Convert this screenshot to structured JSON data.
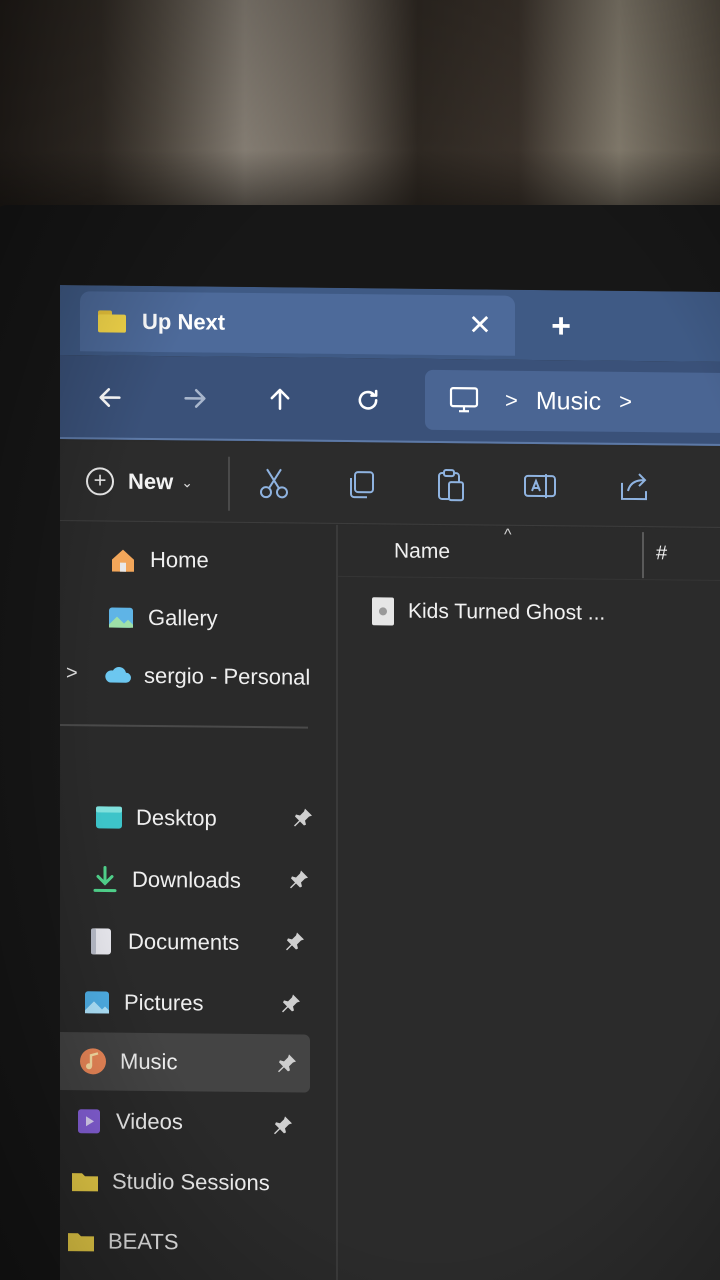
{
  "window": {
    "tab_title": "Up Next",
    "close_symbol": "✕",
    "new_tab_symbol": "+"
  },
  "navigation": {
    "back": "back-arrow-icon",
    "forward": "forward-arrow-icon",
    "up": "up-arrow-icon",
    "refresh": "refresh-icon"
  },
  "address_bar": {
    "root_icon": "computer-icon",
    "segments": [
      "Music"
    ]
  },
  "command_bar": {
    "new_label": "New",
    "icons": [
      "cut-icon",
      "copy-icon",
      "paste-icon",
      "rename-icon",
      "share-icon"
    ]
  },
  "nav_pane": {
    "top_items": [
      {
        "label": "Home",
        "icon": "home-icon"
      },
      {
        "label": "Gallery",
        "icon": "gallery-icon"
      },
      {
        "label": "sergio - Personal",
        "icon": "onedrive-cloud-icon"
      }
    ],
    "quick_access": [
      {
        "label": "Desktop",
        "icon": "desktop-folder-icon",
        "pinned": true
      },
      {
        "label": "Downloads",
        "icon": "downloads-icon",
        "pinned": true
      },
      {
        "label": "Documents",
        "icon": "documents-icon",
        "pinned": true
      },
      {
        "label": "Pictures",
        "icon": "pictures-icon",
        "pinned": true
      },
      {
        "label": "Music",
        "icon": "music-icon",
        "pinned": true,
        "selected": true
      },
      {
        "label": "Videos",
        "icon": "videos-icon",
        "pinned": true
      },
      {
        "label": "Studio Sessions",
        "icon": "folder-icon",
        "pinned": false
      },
      {
        "label": "BEATS",
        "icon": "folder-icon",
        "pinned": false
      }
    ]
  },
  "file_list": {
    "columns": {
      "name": "Name",
      "number": "#"
    },
    "files": [
      {
        "name": "Kids Turned Ghost ..."
      }
    ]
  },
  "colors": {
    "titlebar": "#3f5a85",
    "tab_active": "#4d6a9a",
    "navbar": "#3a5179",
    "address_bar": "#4a6593",
    "folder_yellow": "#f6d94b",
    "background": "#2b2b2b"
  }
}
